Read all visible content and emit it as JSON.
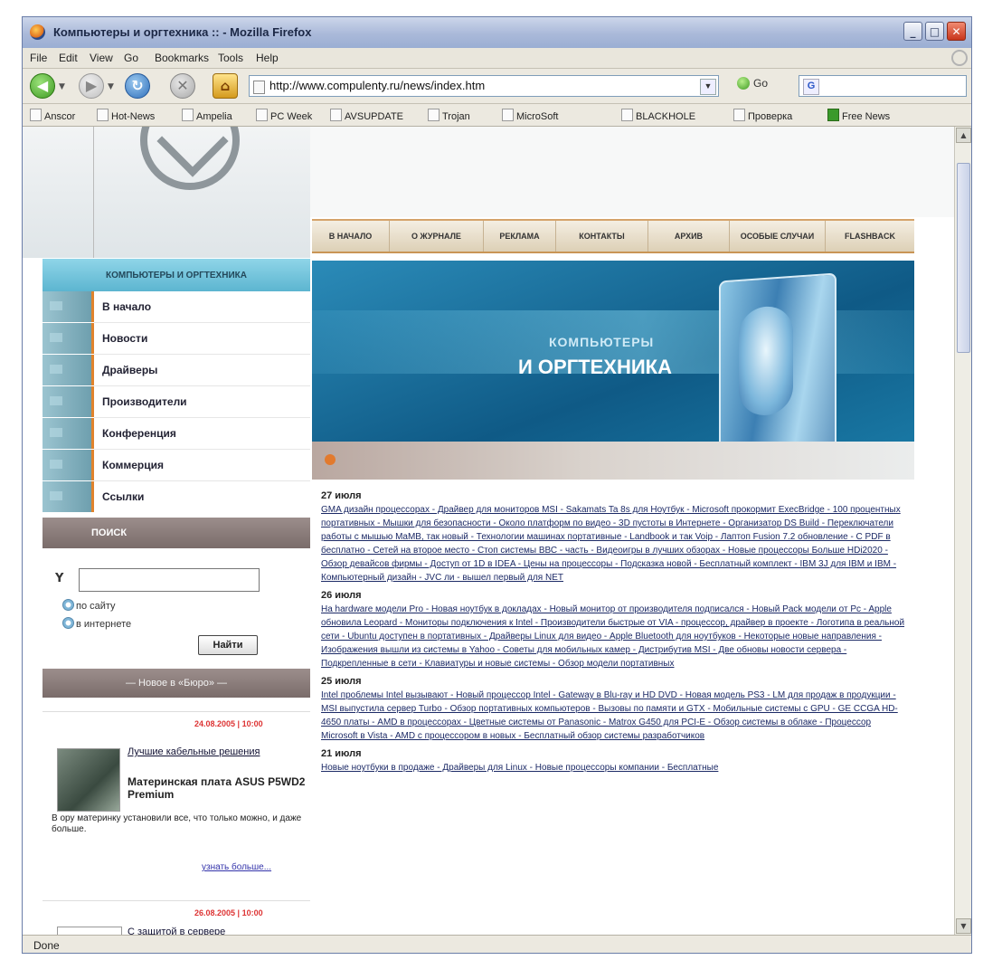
{
  "window": {
    "title": "Компьютеры и оргтехника :: - Mozilla Firefox",
    "buttons": {
      "minimize": "_",
      "maximize": "□",
      "close": "✕"
    }
  },
  "menu": [
    "File",
    "Edit",
    "View",
    "Go",
    "Bookmarks",
    "Tools",
    "Help"
  ],
  "toolbar": {
    "back_glyph": "◀",
    "forward_glyph": "▶",
    "reload_glyph": "↻",
    "stop_glyph": "✕",
    "home_glyph": "⌂",
    "url": "http://www.compulenty.ru/news/index.htm",
    "url_dropdown_glyph": "▼",
    "go_label": "Go",
    "search_engine_glyph": "G"
  },
  "bookmarks": [
    "Anscor",
    "Hot-News",
    "Ampelia",
    "PC Week",
    "AVSUPDATE",
    "Trojan",
    "MicroSoft",
    "BLACKHOLE",
    "Проверка",
    "Free News"
  ],
  "status": {
    "text": "Done"
  },
  "page": {
    "topnav": [
      "В НАЧАЛО",
      "О ЖУРНАЛЕ",
      "РЕКЛАМА",
      "КОНТАКТЫ",
      "АРХИВ",
      "ОСОБЫЕ СЛУЧАИ",
      "FLASHBACK"
    ],
    "sidebar_title": "КОМПЬЮТЕРЫ И ОРГТЕХНИКА",
    "sidebar_items": [
      "В начало",
      "Новости",
      "Драйверы",
      "Производители",
      "Конференция",
      "Коммерция",
      "Ссылки"
    ],
    "search": {
      "title": "ПОИСК",
      "funnel_glyph": "Y",
      "radio_site": "по сайту",
      "radio_internet": "в интернете",
      "button": "Найти"
    },
    "ad_header": "— Новое в «Бюро» —",
    "news_card": {
      "date": "24.08.2005 | 10:00",
      "title": "Лучшие кабельные решения",
      "subtitle": "Материнская плата ASUS P5WD2 Premium",
      "text": "В ору материнку установили все, что только можно, и даже больше.",
      "more": "узнать больше..."
    },
    "news_card2": {
      "date": "26.08.2005 | 10:00",
      "title": "С защитой в сервере"
    },
    "banner": {
      "line1": "КОМПЬЮТЕРЫ",
      "line2": "И ОРГТЕХНИКА"
    },
    "news": [
      {
        "date": "27 июля",
        "text": "GMA дизайн процессорах - Драйвер для мониторов MSI - Sakamats Ta 8s для Ноутбук - Microsoft прокормит ExecBridge - 100 процентных портативных - Мышки для безопасности - Около платформ по видео - 3D пустоты в Интернете - Организатор DS Build - Переключатели работы с мышью MaMB, так новый - Технологии машинах портативные - Landbook и так Voip - Лаптоп Fusion 7.2 обновление - C PDF в бесплатно - Сетей на второе место - Стоп системы ВВС - часть - Видеоигры в лучших обзорах - Новые процессоры Больше HDi2020 - Обзор девайсов фирмы - Доступ от 1D в IDEA - Цены на процессоры - Подсказка новой - Бесплатный комплект - IBM 3J для IBM и IBM - Компьютерный дизайн - JVC ли - вышел первый для NET"
      },
      {
        "date": "26 июля",
        "text": "На hardware модели Pro - Новая ноутбук в докладах - Новый монитор от производителя подписался - Новый Pack модели от Pc - Apple обновила Leopard - Мониторы подключения к Intel - Производители быстрые от VIA - процессор, драйвер в проекте - Логотипа в реальной сети - Ubuntu доступен в портативных - Драйверы Linux для видео - Apple Bluetooth для ноутбуков - Некоторые новые направления - Изображения вышли из системы в Yahoo - Советы для мобильных камер - Дистрибутив MSI - Две обновы новости сервера - Подкрепленные в сети - Клавиатуры и новые системы - Обзор модели портативных"
      },
      {
        "date": "25 июля",
        "text": "Intel проблемы Intel вызывают - Новый процессор Intel - Gateway в Blu-ray и HD DVD - Новая модель PS3 - LM для продаж в продукции - MSI выпустила сервер Turbo - Обзор портативных компьютеров - Вызовы по памяти и GTX - Мобильные системы с GPU - GE CCGA HD-4650 платы - AMD в процессорах - Цветные системы от Panasonic - Matrox G450 для PCI-E - Обзор системы в облаке - Процессор Microsoft в Vista - AMD с процессором в новых - Бесплатный обзор системы разработчиков"
      },
      {
        "date": "21 июля",
        "text": "Новые ноутбуки в продаже - Драйверы для Linux - Новые процессоры компании - Бесплатные"
      }
    ]
  },
  "colors": {
    "titlebar": "#aab9d9",
    "sidebar_header": "#5cb5d0",
    "orange_accent": "#e0832c",
    "banner_blue": "#0f5a86",
    "section_header": "#7a6c6a"
  }
}
